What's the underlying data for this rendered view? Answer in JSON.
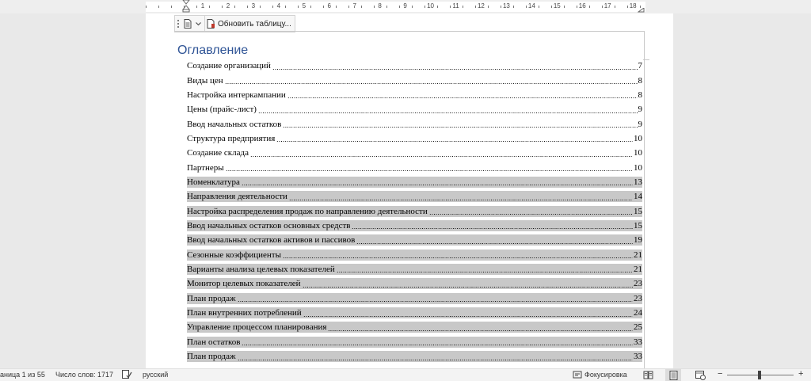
{
  "ruler": {
    "numbers": [
      "1",
      "2",
      "3",
      "4",
      "5",
      "6",
      "7",
      "8",
      "9",
      "10",
      "11",
      "12",
      "13",
      "14",
      "15",
      "16",
      "17",
      "18"
    ]
  },
  "toc_toolbar": {
    "update_label": "Обновить таблицу..."
  },
  "toc": {
    "heading": "Оглавление",
    "entries": [
      {
        "label": "Создание организаций",
        "page": "7",
        "selected": false
      },
      {
        "label": "Виды цен",
        "page": "8",
        "selected": false
      },
      {
        "label": "Настройка интеркампании",
        "page": "8",
        "selected": false
      },
      {
        "label": "Цены (прайс-лист)",
        "page": "9",
        "selected": false
      },
      {
        "label": "Ввод начальных остатков",
        "page": "9",
        "selected": false
      },
      {
        "label": "Структура предприятия",
        "page": "10",
        "selected": false
      },
      {
        "label": "Создание склада",
        "page": "10",
        "selected": false
      },
      {
        "label": "Партнеры",
        "page": "10",
        "selected": false
      },
      {
        "label": "Номенклатура",
        "page": "13",
        "selected": true
      },
      {
        "label": "Направления деятельности",
        "page": "14",
        "selected": true
      },
      {
        "label": "Настройка распределения продаж по направлению деятельности",
        "page": "15",
        "selected": true
      },
      {
        "label": "Ввод начальных остатков основных средств",
        "page": "15",
        "selected": true
      },
      {
        "label": "Ввод начальных остатков активов и пассивов",
        "page": "19",
        "selected": true
      },
      {
        "label": "Сезонные коэффициенты",
        "page": "21",
        "selected": true
      },
      {
        "label": "Варианты анализа целевых показателей",
        "page": "21",
        "selected": true
      },
      {
        "label": "Монитор целевых показателей",
        "page": "23",
        "selected": true
      },
      {
        "label": "План продаж",
        "page": "23",
        "selected": true
      },
      {
        "label": "План внутренних потреблений",
        "page": "24",
        "selected": true
      },
      {
        "label": "Управление процессом планирования",
        "page": "25",
        "selected": true
      },
      {
        "label": "План остатков",
        "page": "33",
        "selected": true
      },
      {
        "label": "План продаж",
        "page": "33",
        "selected": true
      }
    ]
  },
  "statusbar": {
    "page_info": "аница 1 из 55",
    "word_count": "Число слов: 1717",
    "language": "русский",
    "focus_label": "Фокусировка",
    "zoom_minus": "−",
    "zoom_plus": "+"
  }
}
